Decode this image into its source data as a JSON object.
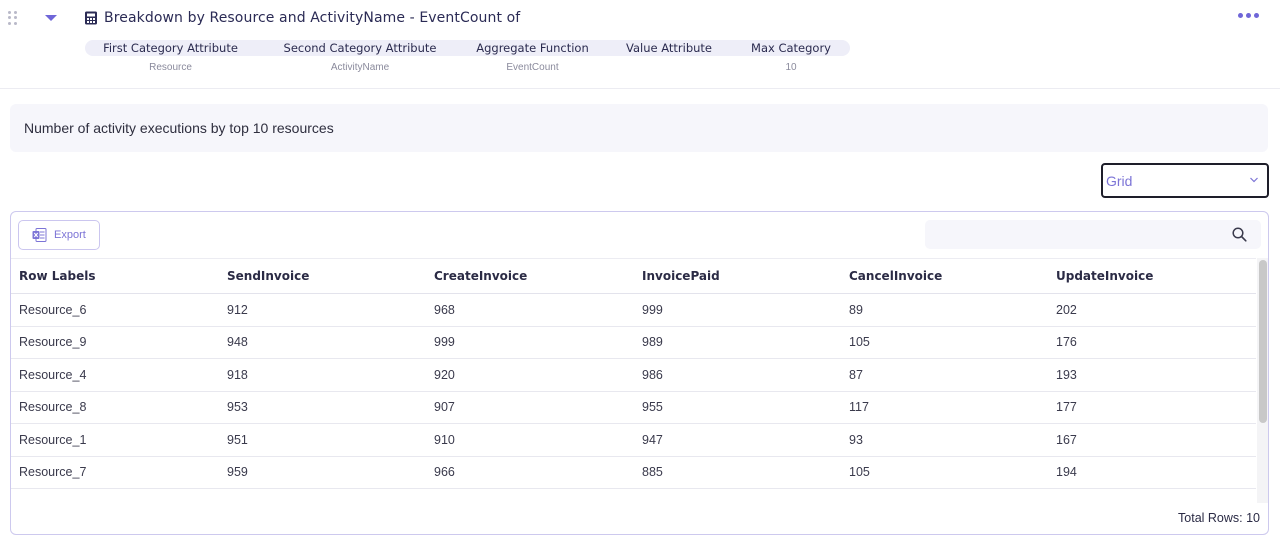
{
  "widget": {
    "title": "Breakdown by Resource and ActivityName - EventCount of",
    "icons": {
      "drag": "drag-handle-icon",
      "caret": "caret-down-icon",
      "title": "calculator-icon",
      "more": "more-horizontal-icon"
    },
    "accent_color": "#6f66d8"
  },
  "params": [
    {
      "label": "First Category Attribute",
      "value": "Resource"
    },
    {
      "label": "Second Category Attribute",
      "value": "ActivityName"
    },
    {
      "label": "Aggregate Function",
      "value": "EventCount"
    },
    {
      "label": "Value Attribute",
      "value": ""
    },
    {
      "label": "Max Category",
      "value": "10"
    }
  ],
  "description": "Number of activity executions by top 10 resources",
  "view_select": {
    "selected": "Grid"
  },
  "grid": {
    "export_label": "Export",
    "search_placeholder": "",
    "columns": [
      "Row Labels",
      "SendInvoice",
      "CreateInvoice",
      "InvoicePaid",
      "CancelInvoice",
      "UpdateInvoice"
    ],
    "rows": [
      [
        "Resource_6",
        "912",
        "968",
        "999",
        "89",
        "202"
      ],
      [
        "Resource_9",
        "948",
        "999",
        "989",
        "105",
        "176"
      ],
      [
        "Resource_4",
        "918",
        "920",
        "986",
        "87",
        "193"
      ],
      [
        "Resource_8",
        "953",
        "907",
        "955",
        "117",
        "177"
      ],
      [
        "Resource_1",
        "951",
        "910",
        "947",
        "93",
        "167"
      ],
      [
        "Resource_7",
        "959",
        "966",
        "885",
        "105",
        "194"
      ]
    ],
    "total_rows": "Total Rows: 10"
  }
}
